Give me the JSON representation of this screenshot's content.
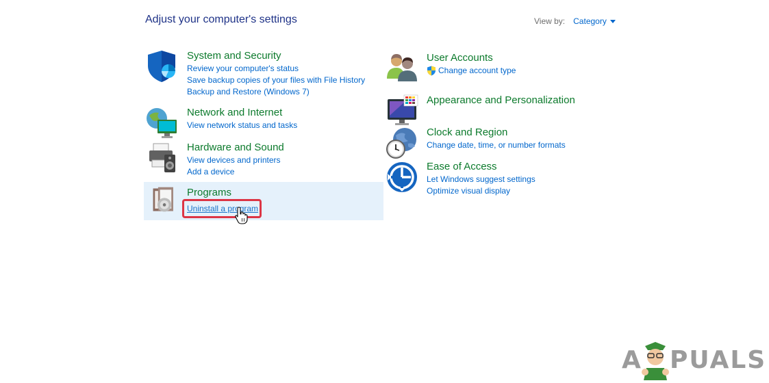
{
  "header": {
    "title": "Adjust your computer's settings",
    "view_by_label": "View by:",
    "view_by_value": "Category"
  },
  "categories": {
    "system_security": {
      "title": "System and Security",
      "links": [
        "Review your computer's status",
        "Save backup copies of your files with File History",
        "Backup and Restore (Windows 7)"
      ],
      "icon": "shield-icon"
    },
    "network_internet": {
      "title": "Network and Internet",
      "links": [
        "View network status and tasks"
      ],
      "icon": "network-globe-icon"
    },
    "hardware_sound": {
      "title": "Hardware and Sound",
      "links": [
        "View devices and printers",
        "Add a device"
      ],
      "icon": "printer-speaker-icon"
    },
    "programs": {
      "title": "Programs",
      "links": [
        "Uninstall a program"
      ],
      "icon": "programs-disc-icon"
    },
    "user_accounts": {
      "title": "User Accounts",
      "links": [
        "Change account type"
      ],
      "icon": "users-icon"
    },
    "appearance": {
      "title": "Appearance and Personalization",
      "links": [],
      "icon": "monitor-palette-icon"
    },
    "clock_region": {
      "title": "Clock and Region",
      "links": [
        "Change date, time, or number formats"
      ],
      "icon": "clock-globe-icon"
    },
    "ease_access": {
      "title": "Ease of Access",
      "links": [
        "Let Windows suggest settings",
        "Optimize visual display"
      ],
      "icon": "ease-of-access-icon"
    }
  },
  "watermark": {
    "text_left": "A",
    "text_right": "PUALS"
  },
  "colors": {
    "title_blue": "#1e3287",
    "category_green": "#0c7a2c",
    "link_blue": "#0066cc",
    "highlight_bg": "#e5f1fb",
    "annotation_red": "#dc3545"
  }
}
